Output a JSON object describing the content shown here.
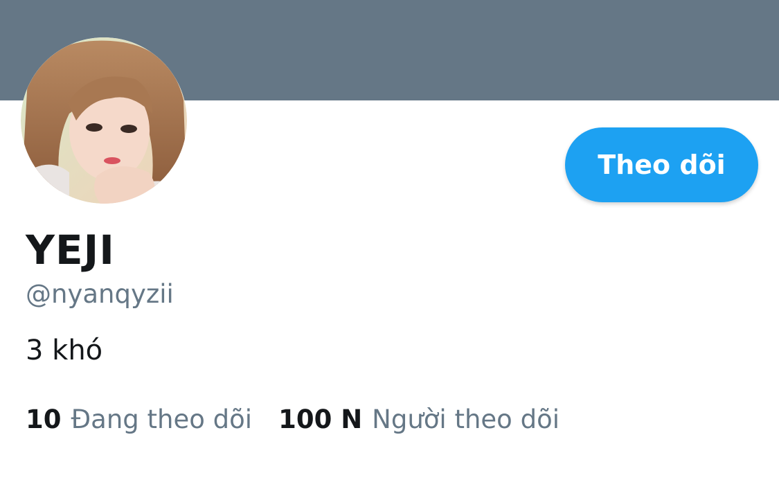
{
  "banner": {
    "color": "#657786"
  },
  "profile": {
    "display_name": "YEJI",
    "handle": "@nyanqyzii",
    "bio": "3 khó"
  },
  "actions": {
    "follow_label": "Theo dõi",
    "accent_color": "#1da1f2"
  },
  "stats": {
    "following": {
      "count": "10",
      "label": "Đang theo dõi"
    },
    "followers": {
      "count": "100 N",
      "label": "Người theo dõi"
    }
  },
  "icons": {
    "avatar": "profile-photo"
  }
}
